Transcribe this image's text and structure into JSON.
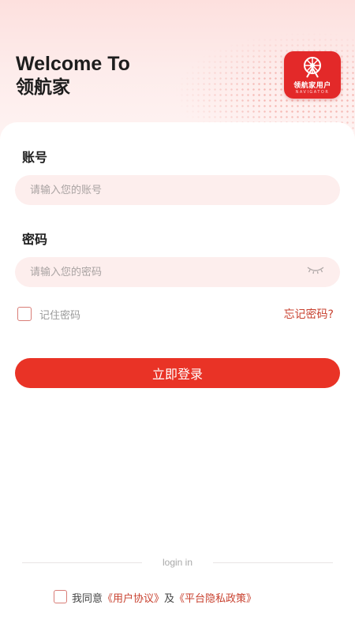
{
  "header": {
    "welcome": "Welcome To",
    "brand": "领航家",
    "logo_text": "领航家用户",
    "logo_subtext": "NAVIGATOR"
  },
  "form": {
    "account": {
      "label": "账号",
      "placeholder": "请输入您的账号",
      "value": ""
    },
    "password": {
      "label": "密码",
      "placeholder": "请输入您的密码",
      "value": "",
      "visibility_icon": "eye-closed-icon"
    },
    "remember": {
      "label": "记住密码",
      "checked": false
    },
    "forgot_label": "忘记密码?",
    "login_button": "立即登录"
  },
  "footer": {
    "divider_text": "login in",
    "agree_prefix": "我同意",
    "user_agreement": "《用户协议》",
    "and": "及",
    "privacy_policy": "《平台隐私政策》",
    "agree_checked": false
  },
  "colors": {
    "primary": "#e93326",
    "link": "#c8412f",
    "input_bg": "#fdeeed",
    "logo_bg": "#e32929"
  }
}
